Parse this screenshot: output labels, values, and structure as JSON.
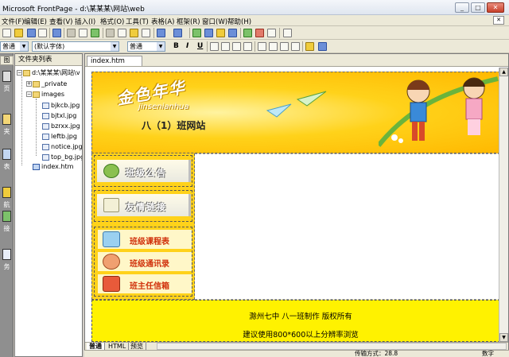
{
  "window": {
    "title": "Microsoft FrontPage - d:\\某某某\\网站\\web",
    "controls": [
      "minimize-icon",
      "maximize-icon",
      "close-icon"
    ]
  },
  "menu": {
    "items": [
      "文件(F)",
      "编辑(E)",
      "查看(V)",
      "插入(I)",
      "格式(O)",
      "工具(T)",
      "表格(A)",
      "框架(R)",
      "窗口(W)",
      "帮助(H)"
    ]
  },
  "toolbar": {
    "style_value": "普通",
    "font_value": "(默认字体)",
    "size_value": "普通",
    "bold_label": "B",
    "italic_label": "I",
    "underline_label": "U"
  },
  "views_bar": {
    "header": "图",
    "items": [
      "页",
      "夹",
      "表",
      "航",
      "接",
      "务"
    ]
  },
  "folder_list": {
    "header": "文件夹列表",
    "root": "d:\\某某某\\网站\\v",
    "folders": [
      "_private",
      "images"
    ],
    "image_files": [
      "bjkcb.jpg",
      "bjtxl.jpg",
      "bzrxx.jpg",
      "leftb.jpg",
      "notice.jpg",
      "top_bg.jpg"
    ],
    "root_files": [
      "index.htm"
    ]
  },
  "editor": {
    "active_tab": "index.htm",
    "banner": {
      "logo_text": "金色年华",
      "logo_pinyin": "jinsenianhua",
      "class_name": "八（1）班网站"
    },
    "nav": {
      "notice": "班级公告",
      "links": "友情链接",
      "items": [
        "班级课程表",
        "班级通讯录",
        "班主任信箱"
      ]
    },
    "footer": {
      "line1": "滁州七中  八一班制作  版权所有",
      "line2": "建议使用800*600以上分辨率浏览"
    },
    "view_tabs": [
      "普通",
      "HTML",
      "预览"
    ]
  },
  "status": {
    "left": "传输方式：28.8",
    "right": "数字"
  },
  "colors": {
    "banner_yellow": "#ffd21a",
    "footer_yellow": "#fff200",
    "nav_red_text": "#d0300a"
  }
}
